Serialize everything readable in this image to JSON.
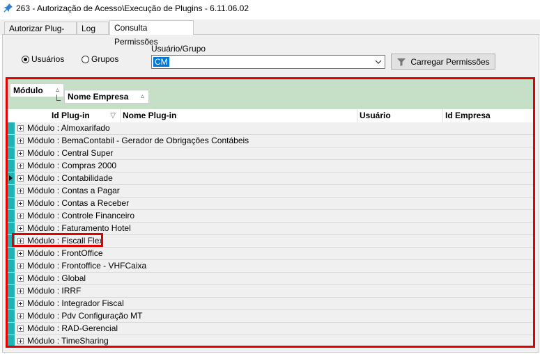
{
  "window": {
    "title": "263 - Autorização de Acesso\\Execução de Plugins - 6.11.06.02",
    "pin_icon": "pin-icon"
  },
  "tabs": [
    {
      "label": "Autorizar Plug-ins",
      "active": false
    },
    {
      "label": "Log",
      "active": false
    },
    {
      "label": "Consulta Permissões",
      "active": true
    }
  ],
  "filter": {
    "radio_usuarios": "Usuários",
    "radio_grupos": "Grupos",
    "selected": "Usuários",
    "user_group_label": "Usuário/Grupo",
    "user_group_value": "CM",
    "load_button": "Carregar Permissões"
  },
  "grid": {
    "group_by": [
      {
        "label": "Módulo",
        "sort": "▵"
      },
      {
        "label": "Nome Empresa",
        "sort": "▵"
      }
    ],
    "columns": [
      {
        "label": "Id Plug-in",
        "sort": "▽"
      },
      {
        "label": "Nome Plug-in"
      },
      {
        "label": "Usuário"
      },
      {
        "label": "Id Empresa"
      }
    ],
    "rows": [
      "Módulo : Almoxarifado",
      "Módulo : BemaContabil - Gerador de Obrigações Contábeis",
      "Módulo : Central Super",
      "Módulo : Compras 2000",
      "Módulo : Contabilidade",
      "Módulo : Contas a Pagar",
      "Módulo : Contas a Receber",
      "Módulo : Controle Financeiro",
      "Módulo : Faturamento Hotel",
      "Módulo : Fiscall Flex",
      "Módulo : FrontOffice",
      "Módulo : Frontoffice - VHFCaixa",
      "Módulo : Global",
      "Módulo : IRRF",
      "Módulo : Integrador Fiscal",
      "Módulo : Pdv Configuração MT",
      "Módulo : RAD-Gerencial",
      "Módulo : TimeSharing"
    ],
    "current_row": "Módulo : Contabilidade",
    "highlighted_row": "Módulo : Fiscall Flex"
  },
  "colors": {
    "highlight_border": "#e00000",
    "groupbar_bg": "#c5e0c7",
    "row_indicator": "#1fb3b3",
    "selection": "#0078d7"
  }
}
